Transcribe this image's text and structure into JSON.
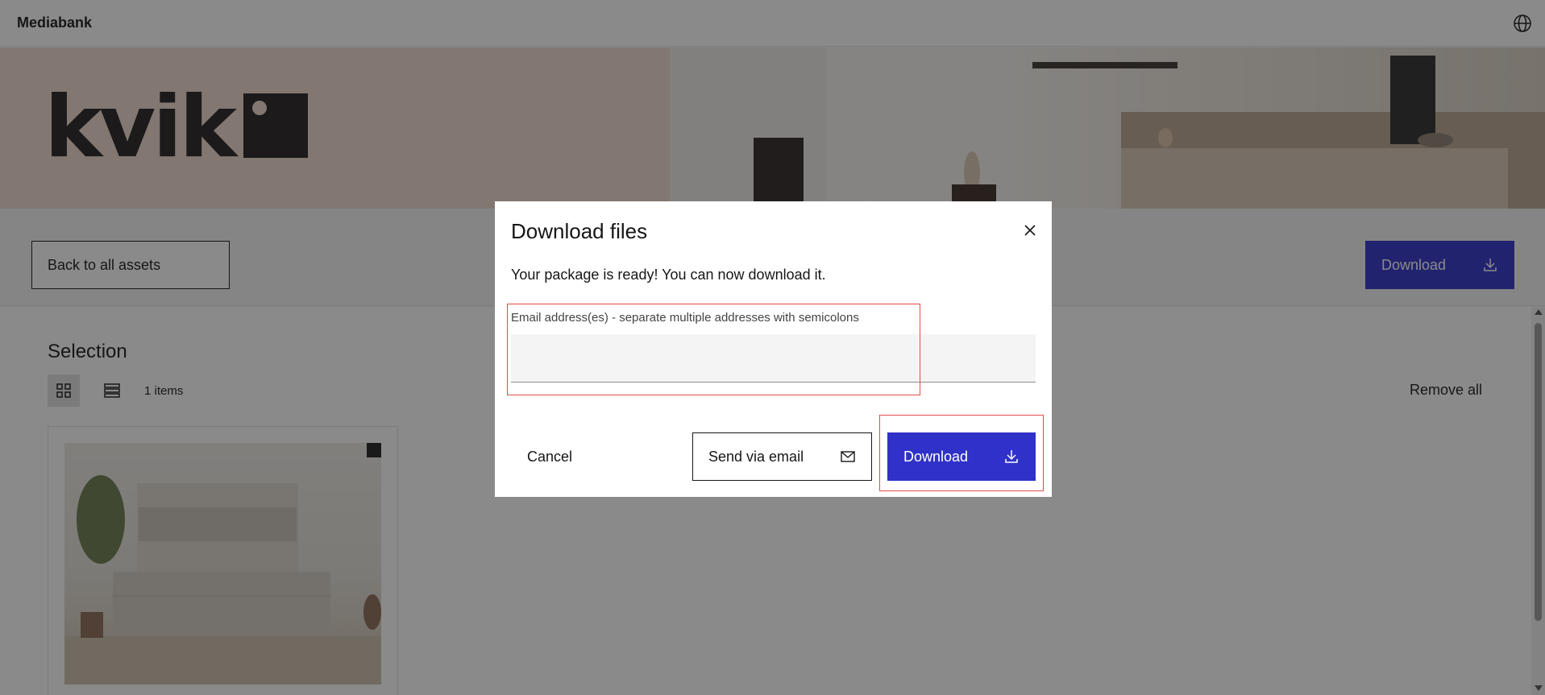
{
  "topbar": {
    "brand": "Mediabank",
    "language_icon": "globe-icon"
  },
  "banner": {
    "logo_text": "kvik"
  },
  "toolbar": {
    "back_label": "Back to all assets",
    "download_label": "Download",
    "download_icon": "download-icon"
  },
  "selection": {
    "title": "Selection",
    "grid_icon": "grid-view-icon",
    "list_icon": "list-view-icon",
    "count": "1 items",
    "remove_all": "Remove all"
  },
  "dialog": {
    "title": "Download files",
    "message": "Your package is ready! You can now download it.",
    "email_label": "Email address(es) - separate multiple addresses with semicolons",
    "email_value": "",
    "email_placeholder": "",
    "cancel_label": "Cancel",
    "send_email_label": "Send via email",
    "send_email_icon": "mail-icon",
    "download_label": "Download",
    "download_icon": "download-icon",
    "close_icon": "close-icon"
  },
  "colors": {
    "primary": "#2f31c9",
    "banner_bg": "#efd9cc",
    "highlight": "#e54b4b"
  }
}
